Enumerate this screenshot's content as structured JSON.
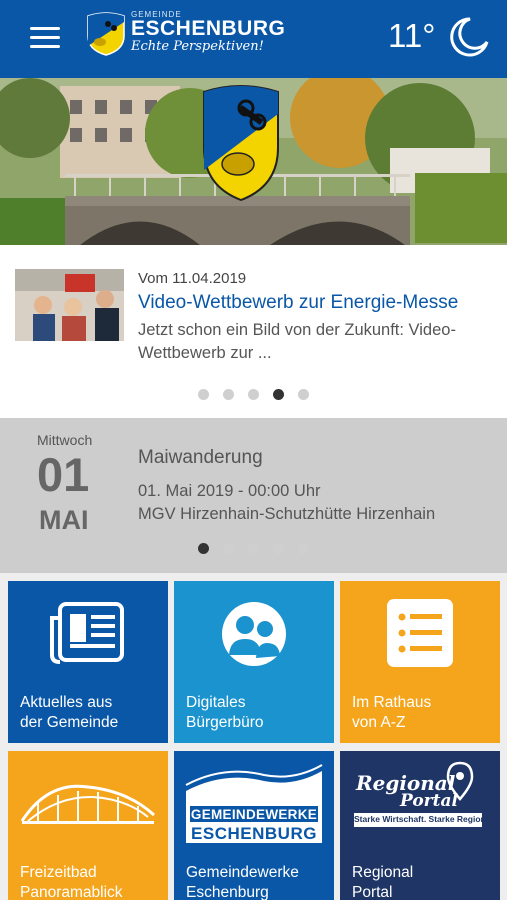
{
  "header": {
    "brand_small": "GEMEINDE",
    "brand_name": "ESCHENBURG",
    "brand_tagline": "Echte Perspektiven!",
    "temperature": "11°",
    "weather_icon": "moon-icon",
    "menu_icon": "hamburger-menu-icon"
  },
  "news": {
    "date": "Vom 11.04.2019",
    "title": "Video-Wettbewerb zur Energie-Messe",
    "excerpt": "Jetzt schon ein Bild von der Zukunft: Video-Wettbewerb zur ...",
    "carousel_pages": 5,
    "active_page": 4
  },
  "event": {
    "weekday": "Mittwoch",
    "day": "01",
    "month": "MAI",
    "title": "Maiwanderung",
    "time": "01. Mai 2019 - 00:00 Uhr",
    "place": "MGV Hirzenhain-Schutzhütte Hirzenhain",
    "carousel_pages": 5,
    "active_page": 1
  },
  "tiles": [
    {
      "label": "Aktuelles aus der Gemeinde",
      "line1": "Aktuelles aus",
      "line2": "der Gemeinde",
      "color": "#0a57a7",
      "icon": "newspaper-icon"
    },
    {
      "label": "Digitales Bürgerbüro",
      "line1": "Digitales",
      "line2": "Bürgerbüro",
      "color": "#1b93cf",
      "icon": "people-icon"
    },
    {
      "label": "Im Rathaus von A-Z",
      "line1": "Im Rathaus",
      "line2": "von A-Z",
      "color": "#f4a51c",
      "icon": "list-icon"
    },
    {
      "label": "Freizeitbad Panoramablick",
      "line1": "Freizeitbad",
      "line2": "Panoramablick",
      "color": "#f4a51c",
      "icon": "panorama-logo-icon"
    },
    {
      "label": "Gemeindewerke Eschenburg",
      "line1": "Gemeindewerke",
      "line2": "Eschenburg",
      "color": "#0a57a7",
      "icon": "gemeindewerke-logo-icon",
      "logo_text1": "GEMEINDEWERKE",
      "logo_text2": "ESCHENBURG"
    },
    {
      "label": "Regional Portal",
      "line1": "Regional",
      "line2": "Portal",
      "color": "#1e3566",
      "icon": "regional-portal-logo-icon",
      "logo_text1": "Regional",
      "logo_text2": "Portal",
      "logo_text3": "Starke Wirtschaft. Starke Region."
    }
  ],
  "colors": {
    "primary": "#0a57a7",
    "light_blue": "#1b93cf",
    "orange": "#f4a51c",
    "navy": "#1e3566"
  }
}
